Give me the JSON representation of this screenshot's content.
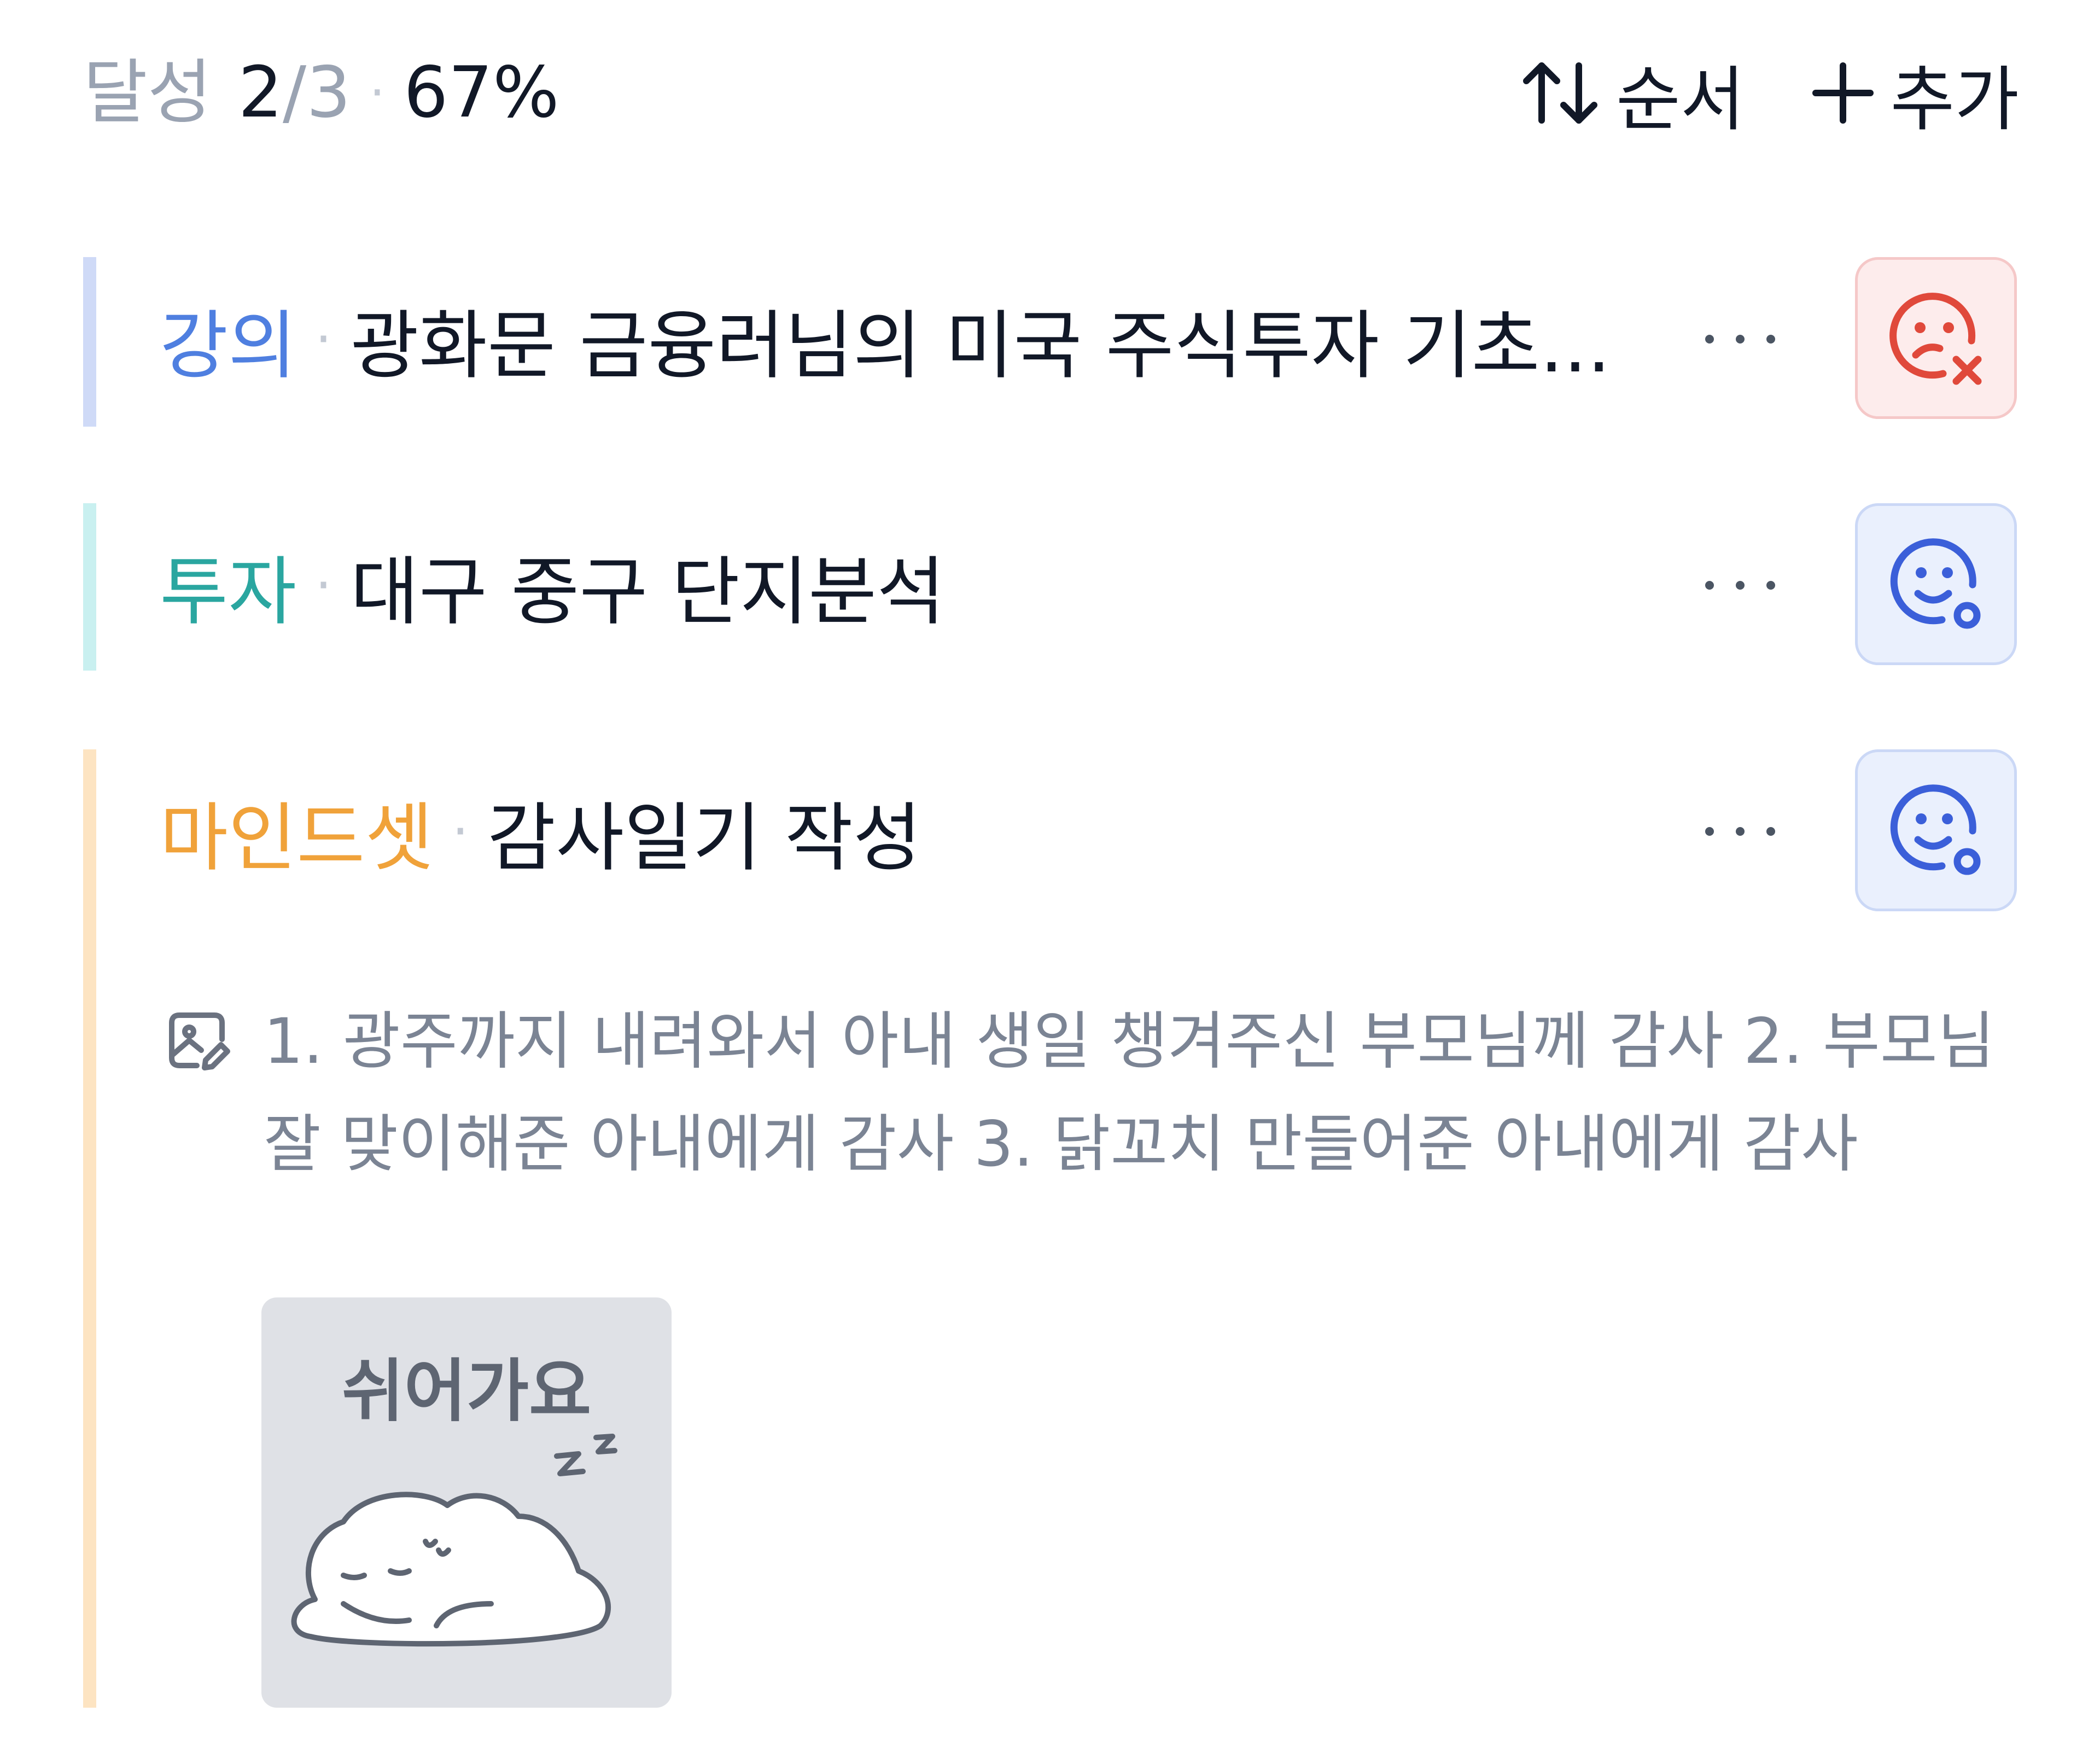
{
  "header": {
    "progress_label": "달성",
    "done": "2",
    "slash": "/",
    "total": "3",
    "separator": "·",
    "percent": "67%",
    "sort_label": "순서",
    "add_label": "추가"
  },
  "tasks": [
    {
      "category": "강의",
      "category_color": "#4f7fe0",
      "bar_color": "#cfdaf7",
      "separator": "·",
      "title": "광화문 금융러님의 미국 주식투자 기초...",
      "mood": "bad",
      "mood_icon": "sad-face-x-icon"
    },
    {
      "category": "투자",
      "category_color": "#2aa6a0",
      "bar_color": "#c9f0f0",
      "separator": "·",
      "title": "대구 중구 단지분석",
      "mood": "good",
      "mood_icon": "happy-face-o-icon"
    },
    {
      "category": "마인드셋",
      "category_color": "#f0a23a",
      "bar_color": "#fde4c2",
      "separator": "·",
      "title": "감사일기 작성",
      "mood": "good",
      "mood_icon": "happy-face-o-icon",
      "memo": "1. 광주까지 내려와서 아내 생일 챙겨주신 부모님께 감사 2. 부모님 잘 맞이해준 아내에게 감사 3. 닭꼬치 만들어준 아내에게 감사",
      "sticker_label": "쉬어가요"
    }
  ],
  "colors": {
    "text_primary": "#111827",
    "text_muted": "#9aa3b2",
    "memo_text": "#7b8494",
    "bad_mood": "#e0493b",
    "good_mood": "#3b5fd9"
  }
}
